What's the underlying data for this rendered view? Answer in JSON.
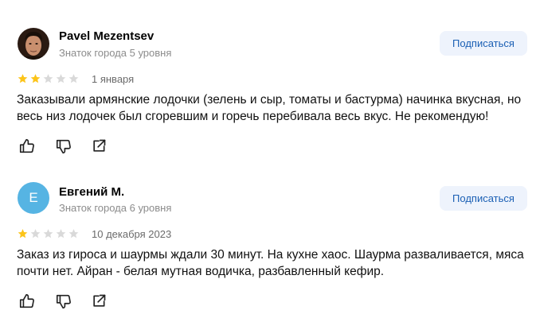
{
  "reviews": [
    {
      "author": "Pavel Mezentsev",
      "level": "Знаток города 5 уровня",
      "avatar_type": "photo",
      "subscribe_label": "Подписаться",
      "rating": 2,
      "max_rating": 5,
      "date": "1 января",
      "text": "Заказывали армянские лодочки (зелень и сыр, томаты и бастурма) начинка вкусная, но весь низ лодочек был сгоревшим и горечь перебивала весь вкус. Не рекомендую!",
      "actions": [
        "thumbs-up-icon",
        "thumbs-down-icon",
        "share-icon"
      ]
    },
    {
      "author": "Евгений М.",
      "level": "Знаток города 6 уровня",
      "avatar_letter": "Е",
      "avatar_color": "#56b4e3",
      "subscribe_label": "Подписаться",
      "rating": 1,
      "max_rating": 5,
      "date": "10 декабря 2023",
      "text": "Заказ из гироса и шаурмы ждали 30 минут. На кухне хаос. Шаурма разваливается, мяса почти нет. Айран - белая мутная водичка, разбавленный кефир.",
      "actions": [
        "thumbs-up-icon",
        "thumbs-down-icon",
        "share-icon"
      ]
    }
  ],
  "colors": {
    "star_filled": "#fcc419",
    "star_empty": "#d9d9d9",
    "subscribe_bg": "#eef3fc",
    "subscribe_text": "#1a5fb4",
    "muted_text": "#8c8c8c"
  }
}
